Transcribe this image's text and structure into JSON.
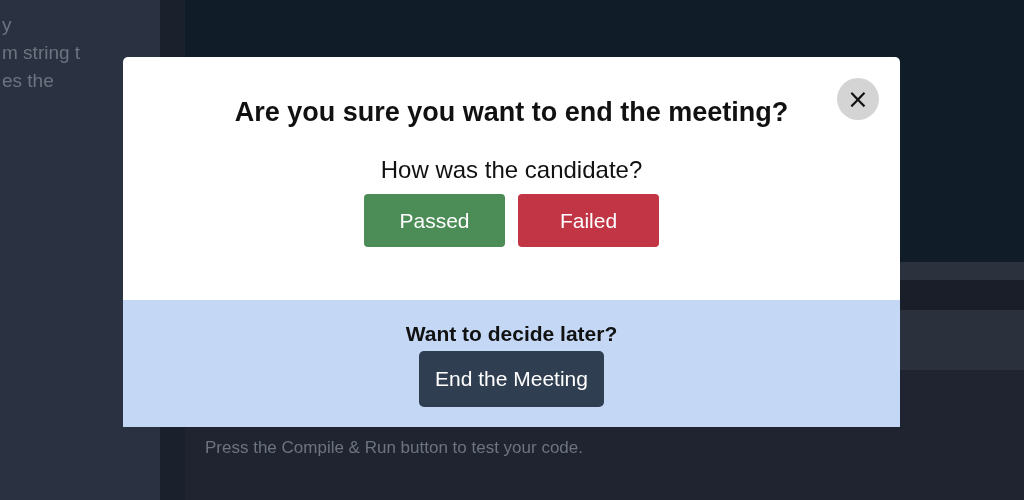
{
  "background": {
    "sidebar_lines": [
      "y",
      "m string t",
      "es the"
    ],
    "console_text": "Press the Compile & Run button to test your code."
  },
  "dialog": {
    "close": "×",
    "title": "Are you sure you want to end the meeting?",
    "question": "How was the candidate?",
    "choices": [
      {
        "label": "Passed",
        "kind": "pass"
      },
      {
        "label": "Failed",
        "kind": "fail"
      }
    ],
    "footer": {
      "prompt": "Want to decide later?",
      "button": "End the Meeting"
    }
  }
}
